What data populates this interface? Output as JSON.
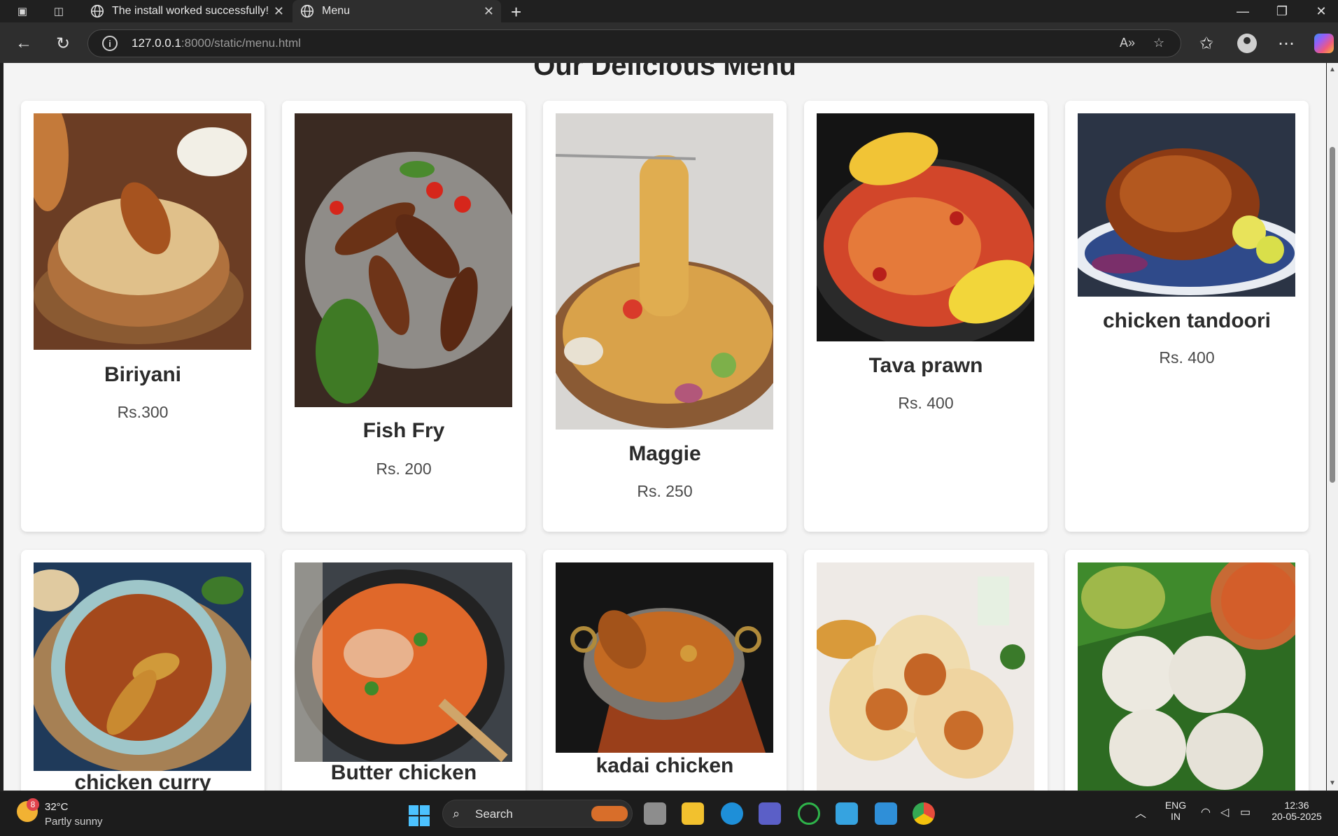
{
  "browser": {
    "tabs": [
      {
        "title": "The install worked successfully! Co",
        "active": false
      },
      {
        "title": "Menu",
        "active": true
      }
    ],
    "url_host": "127.0.0.1",
    "url_rest": ":8000/static/menu.html"
  },
  "page": {
    "heading": "Our Delicious Menu",
    "items": [
      {
        "name": "Biriyani",
        "price": "Rs.300"
      },
      {
        "name": "Fish Fry",
        "price": "Rs. 200"
      },
      {
        "name": "Maggie",
        "price": "Rs. 250"
      },
      {
        "name": "Tava prawn",
        "price": "Rs. 400"
      },
      {
        "name": "chicken tandoori",
        "price": "Rs. 400"
      },
      {
        "name": "chicken curry",
        "price": ""
      },
      {
        "name": "Butter chicken",
        "price": ""
      },
      {
        "name": "kadai chicken",
        "price": ""
      },
      {
        "name": "",
        "price": ""
      },
      {
        "name": "",
        "price": ""
      }
    ]
  },
  "taskbar": {
    "weather_badge": "8",
    "temperature": "32°C",
    "weather": "Partly sunny",
    "search_label": "Search",
    "lang_top": "ENG",
    "lang_bottom": "IN",
    "time": "12:36",
    "date": "20-05-2025"
  },
  "colors": {
    "accent": "#4cc2ff",
    "page_bg": "#f4f4f4",
    "card_bg": "#ffffff"
  }
}
